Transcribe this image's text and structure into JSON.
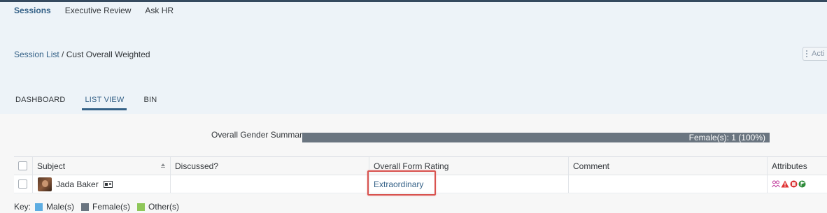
{
  "top_nav": {
    "items": [
      {
        "label": "Sessions",
        "active": true
      },
      {
        "label": "Executive Review",
        "active": false
      },
      {
        "label": "Ask HR",
        "active": false
      }
    ]
  },
  "breadcrumb": {
    "link": "Session List",
    "separator": "/",
    "current": "Cust Overall Weighted"
  },
  "actions_button": {
    "label": "Acti"
  },
  "tabs": [
    {
      "label": "DASHBOARD",
      "active": false
    },
    {
      "label": "LIST VIEW",
      "active": true
    },
    {
      "label": "BIN",
      "active": false
    }
  ],
  "gender_summary": {
    "label": "Overall Gender Summary",
    "bar_text": "Female(s): 1 (100%)",
    "female_fraction": 1.0,
    "bar_color": "#6a7580"
  },
  "table": {
    "columns": [
      "Subject",
      "Discussed?",
      "Overall Form Rating",
      "Comment",
      "Attributes"
    ],
    "rows": [
      {
        "subject": "Jada Baker",
        "discussed": "",
        "overall_form_rating": "Extraordinary",
        "comment": "",
        "attribute_icons": [
          "group-icon",
          "warning-triangle-icon",
          "red-circle-icon",
          "green-flag-icon"
        ]
      }
    ]
  },
  "key": {
    "label": "Key:",
    "items": [
      {
        "label": "Male(s)",
        "color": "#5dade2"
      },
      {
        "label": "Female(s)",
        "color": "#6a7580"
      },
      {
        "label": "Other(s)",
        "color": "#8fc75a"
      }
    ]
  },
  "colors": {
    "accent": "#346187",
    "header_background": "#edf3f8",
    "highlight_border": "#d9534f"
  }
}
